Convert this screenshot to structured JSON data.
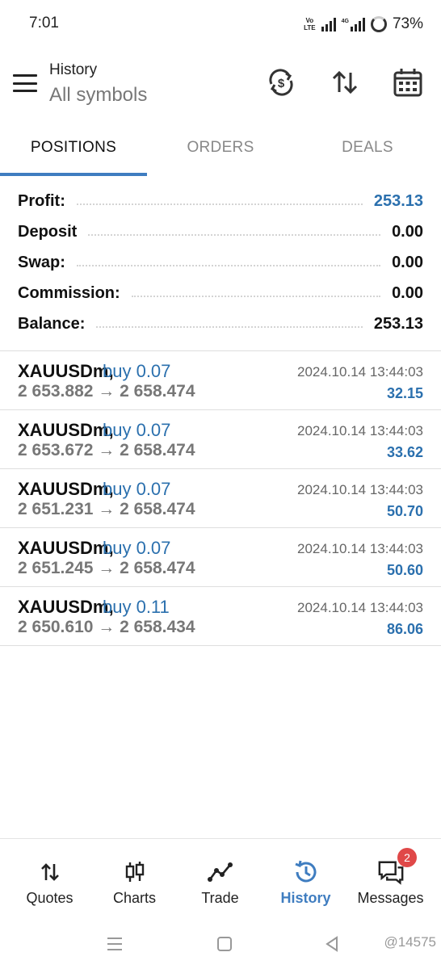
{
  "status_bar": {
    "time": "7:01",
    "volte_line1": "Vo",
    "volte_line2": "LTE",
    "net_label": "4G",
    "battery": "73%"
  },
  "header": {
    "title": "History",
    "subtitle": "All symbols",
    "icons": [
      "currency-sync-icon",
      "sort-icon",
      "calendar-icon"
    ]
  },
  "tabs": [
    {
      "label": "POSITIONS",
      "active": true
    },
    {
      "label": "ORDERS",
      "active": false
    },
    {
      "label": "DEALS",
      "active": false
    }
  ],
  "summary": {
    "profit_label": "Profit:",
    "profit_value": "253.13",
    "deposit_label": "Deposit",
    "deposit_value": "0.00",
    "swap_label": "Swap:",
    "swap_value": "0.00",
    "commission_label": "Commission:",
    "commission_value": "0.00",
    "balance_label": "Balance:",
    "balance_value": "253.13"
  },
  "deals": [
    {
      "symbol": "XAUUSDm,",
      "side": "buy 0.07",
      "prices": "2 653.882 → 2 658.474",
      "time": "2024.10.14 13:44:03",
      "profit": "32.15"
    },
    {
      "symbol": "XAUUSDm,",
      "side": "buy 0.07",
      "prices": "2 653.672 → 2 658.474",
      "time": "2024.10.14 13:44:03",
      "profit": "33.62"
    },
    {
      "symbol": "XAUUSDm,",
      "side": "buy 0.07",
      "prices": "2 651.231 → 2 658.474",
      "time": "2024.10.14 13:44:03",
      "profit": "50.70"
    },
    {
      "symbol": "XAUUSDm,",
      "side": "buy 0.07",
      "prices": "2 651.245 → 2 658.474",
      "time": "2024.10.14 13:44:03",
      "profit": "50.60"
    },
    {
      "symbol": "XAUUSDm,",
      "side": "buy 0.11",
      "prices": "2 650.610 → 2 658.434",
      "time": "2024.10.14 13:44:03",
      "profit": "86.06"
    }
  ],
  "bottom_nav": [
    {
      "label": "Quotes",
      "icon": "quotes-icon",
      "active": false
    },
    {
      "label": "Charts",
      "icon": "candlestick-icon",
      "active": false
    },
    {
      "label": "Trade",
      "icon": "trade-line-icon",
      "active": false
    },
    {
      "label": "History",
      "icon": "history-icon",
      "active": true
    },
    {
      "label": "Messages",
      "icon": "messages-icon",
      "active": false,
      "badge": "2"
    }
  ],
  "watermark": "@14575",
  "colors": {
    "accent": "#3f7dc0",
    "value_blue": "#2b70ae",
    "badge_red": "#e04848"
  }
}
